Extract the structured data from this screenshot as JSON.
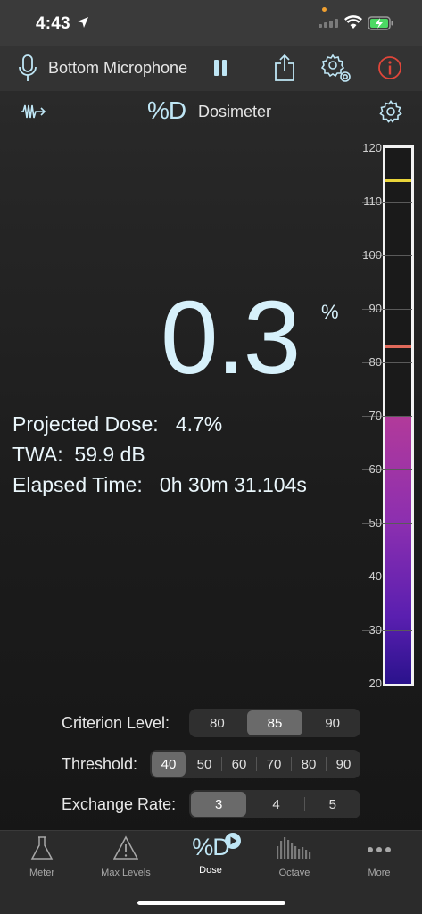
{
  "status": {
    "time": "4:43"
  },
  "toolbar": {
    "microphone": "Bottom Microphone"
  },
  "header": {
    "logo": "%D",
    "title": "Dosimeter"
  },
  "reading": {
    "dose": "0.3",
    "unit": "%"
  },
  "stats": {
    "projected_label": "Projected Dose:",
    "projected_value": "4.7%",
    "twa_label": "TWA:",
    "twa_value": "59.9 dB",
    "elapsed_label": "Elapsed Time:",
    "elapsed_value": "0h 30m 31.104s"
  },
  "meter": {
    "scale": [
      "120",
      "110",
      "100",
      "90",
      "80",
      "70",
      "60",
      "50",
      "40",
      "30",
      "20"
    ],
    "scale_min": 20,
    "scale_max": 120,
    "level_db": 70,
    "peak_db": 114,
    "marker_db": 83,
    "peak_color": "#e9d43a",
    "marker_color": "#e0695a"
  },
  "controls": {
    "criterion": {
      "label": "Criterion Level:",
      "options": [
        "80",
        "85",
        "90"
      ],
      "selected": "85"
    },
    "threshold": {
      "label": "Threshold:",
      "options": [
        "40",
        "50",
        "60",
        "70",
        "80",
        "90"
      ],
      "selected": "40"
    },
    "exchange": {
      "label": "Exchange Rate:",
      "options": [
        "3",
        "4",
        "5"
      ],
      "selected": "3"
    }
  },
  "tabs": [
    {
      "label": "Meter",
      "icon": "flask-icon"
    },
    {
      "label": "Max Levels",
      "icon": "warning-icon"
    },
    {
      "label": "Dose",
      "icon": "dose-icon",
      "active": true
    },
    {
      "label": "Octave",
      "icon": "octave-bars-icon"
    },
    {
      "label": "More",
      "icon": "more-dots-icon"
    }
  ],
  "colors": {
    "accent": "#bfe6f5",
    "info": "#e0463a",
    "fill_top": "#b23a9a",
    "fill_bottom": "#2a128c"
  }
}
